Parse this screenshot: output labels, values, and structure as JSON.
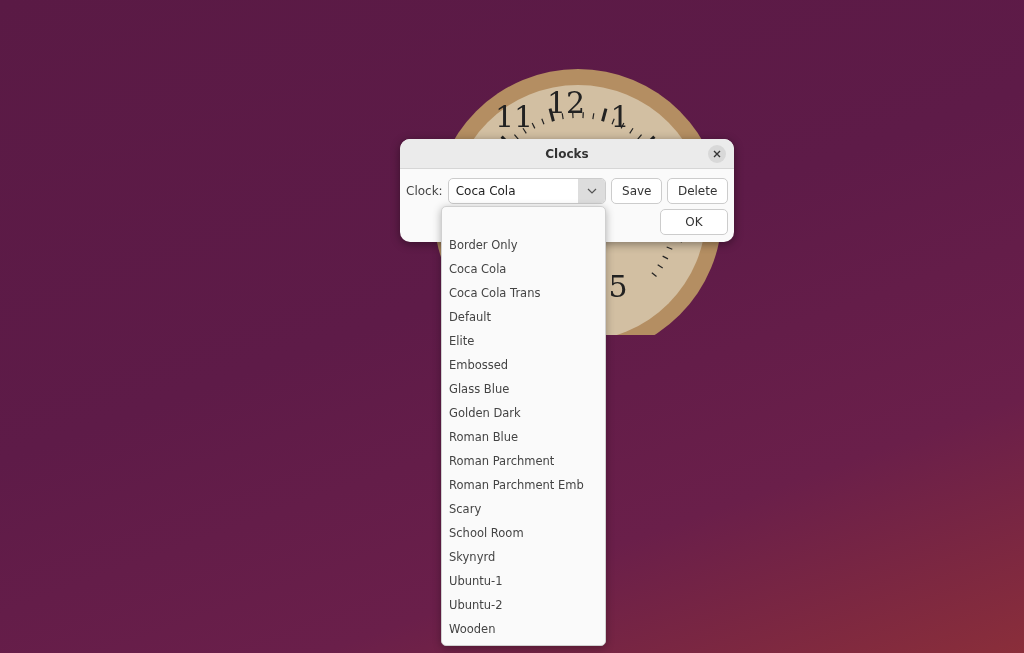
{
  "desktop_clock": {
    "numerals": [
      "11",
      "12",
      "1",
      "5"
    ]
  },
  "dialog": {
    "title": "Clocks",
    "clock_label": "Clock:",
    "combo_value": "Coca Cola",
    "buttons": [
      "Save",
      "Delete",
      "OK"
    ]
  },
  "dropdown": {
    "items": [
      "Border Only",
      "Coca Cola",
      "Coca Cola Trans",
      "Default",
      "Elite",
      "Embossed",
      "Glass Blue",
      "Golden Dark",
      "Roman Blue",
      "Roman Parchment",
      "Roman Parchment Emb",
      "Scary",
      "School Room",
      "Skynyrd",
      "Ubuntu-1",
      "Ubuntu-2",
      "Wooden"
    ]
  }
}
